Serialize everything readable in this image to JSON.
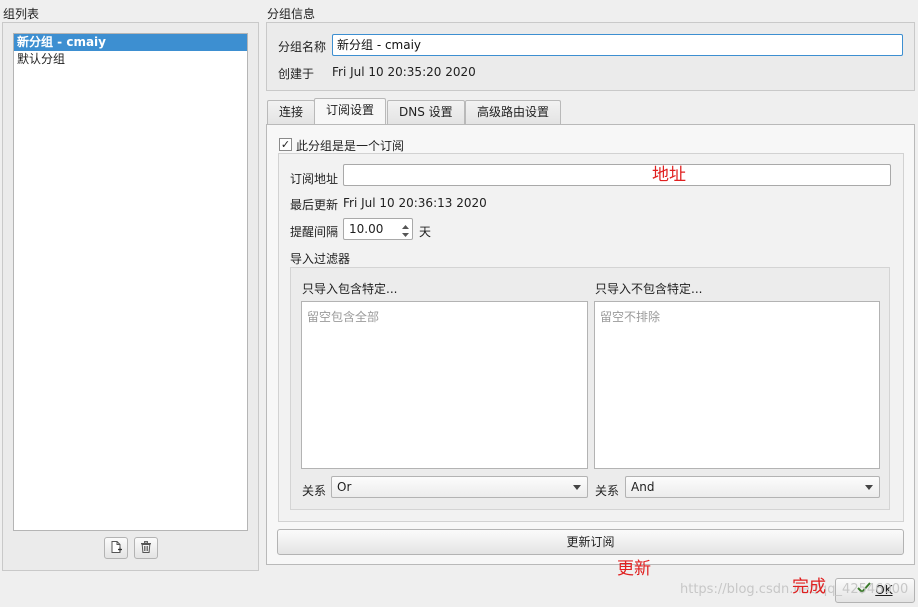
{
  "left": {
    "title": "组列表",
    "items": [
      {
        "label": "新分组 - cmaiy",
        "selected": true
      },
      {
        "label": "默认分组",
        "selected": false
      }
    ]
  },
  "info": {
    "title": "分组信息",
    "name_label": "分组名称",
    "name_value": "新分组 - cmaiy",
    "created_label": "创建于",
    "created_value": "Fri Jul 10 20:35:20 2020"
  },
  "tabs": [
    {
      "label": "连接",
      "active": false
    },
    {
      "label": "订阅设置",
      "active": true
    },
    {
      "label": "DNS 设置",
      "active": false
    },
    {
      "label": "高级路由设置",
      "active": false
    }
  ],
  "subscription": {
    "checkbox_label": "此分组是是一个订阅",
    "checked": true,
    "check_glyph": "✓",
    "url_label": "订阅地址",
    "url_value": "",
    "last_update_label": "最后更新",
    "last_update_value": "Fri Jul 10 20:36:13 2020",
    "interval_label": "提醒间隔",
    "interval_value": "10.00",
    "interval_unit": "天"
  },
  "filter": {
    "title": "导入过滤器",
    "include_label": "只导入包含特定...",
    "include_placeholder": "留空包含全部",
    "exclude_label": "只导入不包含特定...",
    "exclude_placeholder": "留空不排除",
    "relation_label": "关系",
    "include_relation": "Or",
    "exclude_relation": "And"
  },
  "update_button": "更新订阅",
  "ok_button": "OK",
  "annotations": {
    "address": "地址",
    "update": "更新",
    "done": "完成"
  },
  "watermark": "https://blog.csdn.net/qq_42546000",
  "colors": {
    "selection": "#3d8fd1",
    "annotation": "#e02020",
    "focus_border": "#3d8fd1"
  }
}
